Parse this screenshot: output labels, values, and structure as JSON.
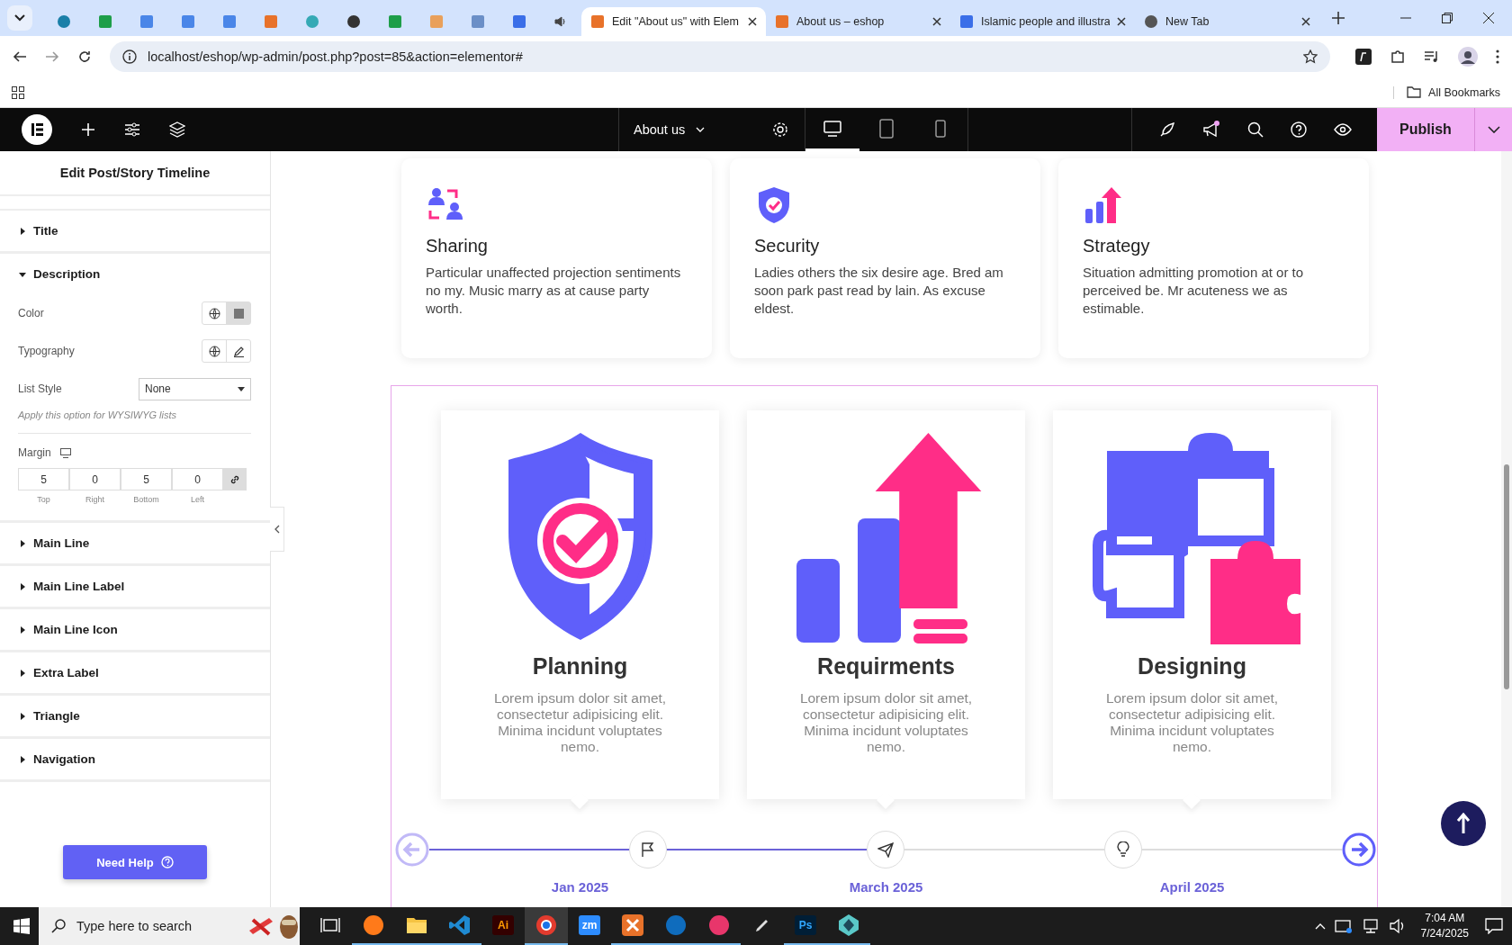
{
  "browser": {
    "tabs": [
      {
        "kind": "ring",
        "selected": false
      },
      {
        "kind": "sheet",
        "selected": false
      },
      {
        "kind": "doc",
        "selected": false
      },
      {
        "kind": "doc",
        "selected": false
      },
      {
        "kind": "doc",
        "selected": false
      },
      {
        "kind": "xampp",
        "selected": false
      },
      {
        "kind": "dot",
        "selected": false
      },
      {
        "kind": "knot",
        "selected": false
      },
      {
        "kind": "sheet",
        "selected": false
      },
      {
        "kind": "hand",
        "selected": false
      },
      {
        "kind": "grid",
        "selected": false
      },
      {
        "kind": "form",
        "selected": false
      },
      {
        "kind": "audio",
        "selected": false
      },
      {
        "kind": "xampp",
        "label": "Edit \"About us\" with Elem",
        "selected": true
      },
      {
        "kind": "xampp",
        "label": "About us – eshop",
        "selected": false
      },
      {
        "kind": "form",
        "label": "Islamic people and illustra",
        "selected": false
      },
      {
        "kind": "chrome",
        "label": "New Tab",
        "selected": false
      }
    ],
    "address": "localhost/eshop/wp-admin/post.php?post=85&action=elementor#",
    "bookmarks_label": "All Bookmarks"
  },
  "editor": {
    "page_title": "About us",
    "devices": [
      {
        "kind": "desktop",
        "selected": true
      },
      {
        "kind": "tablet",
        "selected": false
      },
      {
        "kind": "mobile",
        "selected": false
      }
    ],
    "notification": true,
    "publish": "Publish"
  },
  "panel": {
    "title": "Edit Post/Story Timeline",
    "sections": [
      {
        "label": "Title",
        "expanded": false
      },
      {
        "label": "Description",
        "expanded": true
      },
      {
        "label": "Main Line",
        "expanded": false
      },
      {
        "label": "Main Line Label",
        "expanded": false
      },
      {
        "label": "Main Line Icon",
        "expanded": false
      },
      {
        "label": "Extra Label",
        "expanded": false
      },
      {
        "label": "Triangle",
        "expanded": false
      },
      {
        "label": "Navigation",
        "expanded": false
      }
    ],
    "description": {
      "color_label": "Color",
      "typography_label": "Typography",
      "list_style_label": "List Style",
      "list_style_value": "None",
      "hint": "Apply this option for WYSIWYG lists",
      "margin_label": "Margin",
      "margin": [
        {
          "value": "5",
          "label": "Top"
        },
        {
          "value": "0",
          "label": "Right"
        },
        {
          "value": "5",
          "label": "Bottom"
        },
        {
          "value": "0",
          "label": "Left"
        }
      ]
    },
    "help": "Need Help"
  },
  "features": [
    {
      "kind": "sharing",
      "title": "Sharing",
      "text": "Particular unaffected projection sentiments no my. Music marry as at cause party worth."
    },
    {
      "kind": "security",
      "title": "Security",
      "text": "Ladies others the six desire age. Bred am soon park past read by lain. As excuse eldest."
    },
    {
      "kind": "strategy",
      "title": "Strategy",
      "text": "Situation admitting promotion at or to perceived be. Mr acuteness we as estimable."
    }
  ],
  "timeline": {
    "prev_disabled": true,
    "next_disabled": false,
    "items": [
      {
        "kind": "shield",
        "marker": {
          "kind": "flag"
        },
        "reached": true,
        "title": "Planning",
        "text": "Lorem ipsum dolor sit amet, consectetur adipisicing elit. Minima incidunt voluptates nemo.",
        "date": "Jan 2025"
      },
      {
        "kind": "growth",
        "marker": {
          "kind": "plane"
        },
        "reached": true,
        "title": "Requirments",
        "text": "Lorem ipsum dolor sit amet, consectetur adipisicing elit. Minima incidunt voluptates nemo.",
        "date": "March 2025"
      },
      {
        "kind": "puzzle",
        "marker": {
          "kind": "bulb"
        },
        "reached": false,
        "title": "Designing",
        "text": "Lorem ipsum dolor sit amet, consectetur adipisicing elit. Minima incidunt voluptates nemo.",
        "date": "April 2025"
      }
    ]
  },
  "taskbar": {
    "search_placeholder": "Type here to search",
    "apps": [
      {
        "kind": "taskview",
        "running": false,
        "selected": false
      },
      {
        "kind": "firefox",
        "running": true,
        "selected": false
      },
      {
        "kind": "folder",
        "running": true,
        "selected": false
      },
      {
        "kind": "vscode",
        "running": true,
        "selected": false
      },
      {
        "kind": "letters",
        "label": "Ai",
        "running": false,
        "selected": false
      },
      {
        "kind": "chrome",
        "running": true,
        "selected": true
      },
      {
        "kind": "letters",
        "label": "zm",
        "running": false,
        "selected": false
      },
      {
        "kind": "xampp",
        "running": true,
        "selected": false
      },
      {
        "kind": "outlook",
        "running": true,
        "selected": false
      },
      {
        "kind": "cloud",
        "running": true,
        "selected": false
      },
      {
        "kind": "pen",
        "running": false,
        "selected": false
      },
      {
        "kind": "letters",
        "label": "Ps",
        "running": true,
        "selected": false
      },
      {
        "kind": "gem",
        "running": true,
        "selected": false
      }
    ],
    "time": "7:04 AM",
    "date": "7/24/2025"
  }
}
